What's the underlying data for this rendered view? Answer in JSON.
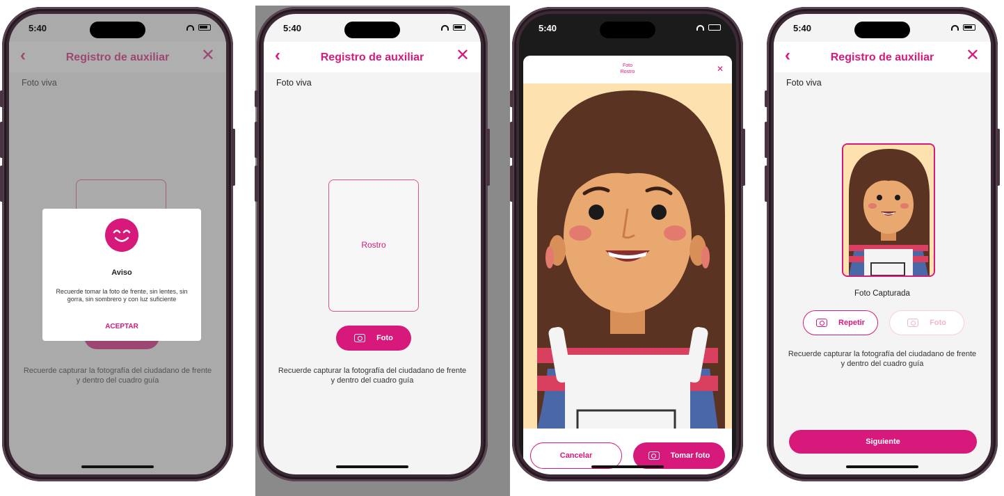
{
  "status_time": "5:40",
  "nav": {
    "title": "Registro de auxiliar",
    "back_icon": "chevron-left-icon",
    "close_icon": "close-icon"
  },
  "section_label": "Foto viva",
  "guide_label": "Rostro",
  "photo_button": "Foto",
  "hint": "Recuerde capturar la fotografía del ciudadano de frente y dentro del cuadro guía",
  "modal": {
    "title": "Aviso",
    "body": "Recuerde tomar la foto de frente, sin lentes, sin gorra, sin sombrero y con luz suficiente",
    "button": "ACEPTAR"
  },
  "camera": {
    "title_line1": "Foto",
    "title_line2": "Rostro",
    "cancel": "Cancelar",
    "take_photo": "Tomar foto"
  },
  "captured": {
    "label": "Foto Capturada",
    "retry": "Repetir",
    "disabled_photo": "Foto",
    "next": "Siguiente"
  },
  "colors": {
    "accent": "#d6197a",
    "skin": "#e8a870",
    "hair": "#5b3322",
    "bg_peach": "#fde2b0"
  }
}
